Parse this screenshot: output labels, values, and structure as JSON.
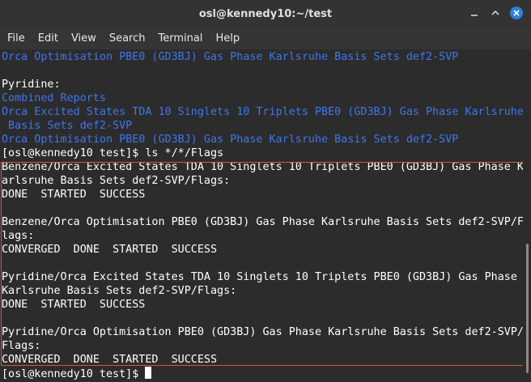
{
  "window": {
    "title": "osl@kennedy10:~/test"
  },
  "menu": [
    "File",
    "Edit",
    "View",
    "Search",
    "Terminal",
    "Help"
  ],
  "terminal_lines": [
    {
      "text": "Orca Optimisation PBE0 (GD3BJ) Gas Phase Karlsruhe Basis Sets def2-SVP",
      "color": "blue"
    },
    {
      "text": "",
      "color": "white"
    },
    {
      "text": "Pyridine:",
      "color": "white"
    },
    {
      "text": "Combined Reports",
      "color": "blue"
    },
    {
      "text": "Orca Excited States TDA 10 Singlets 10 Triplets PBE0 (GD3BJ) Gas Phase Karlsruhe",
      "color": "blue"
    },
    {
      "text": " Basis Sets def2-SVP",
      "color": "blue"
    },
    {
      "text": "Orca Optimisation PBE0 (GD3BJ) Gas Phase Karlsruhe Basis Sets def2-SVP",
      "color": "blue"
    },
    {
      "text": "[osl@kennedy10 test]$ ls */*/Flags",
      "color": "white"
    },
    {
      "text": "Benzene/Orca Excited States TDA 10 Singlets 10 Triplets PBE0 (GD3BJ) Gas Phase K",
      "color": "white"
    },
    {
      "text": "arlsruhe Basis Sets def2-SVP/Flags:",
      "color": "white"
    },
    {
      "text": "DONE  STARTED  SUCCESS",
      "color": "white"
    },
    {
      "text": "",
      "color": "white"
    },
    {
      "text": "Benzene/Orca Optimisation PBE0 (GD3BJ) Gas Phase Karlsruhe Basis Sets def2-SVP/F",
      "color": "white"
    },
    {
      "text": "lags:",
      "color": "white"
    },
    {
      "text": "CONVERGED  DONE  STARTED  SUCCESS",
      "color": "white"
    },
    {
      "text": "",
      "color": "white"
    },
    {
      "text": "Pyridine/Orca Excited States TDA 10 Singlets 10 Triplets PBE0 (GD3BJ) Gas Phase",
      "color": "white"
    },
    {
      "text": "Karlsruhe Basis Sets def2-SVP/Flags:",
      "color": "white"
    },
    {
      "text": "DONE  STARTED  SUCCESS",
      "color": "white"
    },
    {
      "text": "",
      "color": "white"
    },
    {
      "text": "Pyridine/Orca Optimisation PBE0 (GD3BJ) Gas Phase Karlsruhe Basis Sets def2-SVP/",
      "color": "white"
    },
    {
      "text": "Flags:",
      "color": "white"
    },
    {
      "text": "CONVERGED  DONE  STARTED  SUCCESS",
      "color": "white"
    },
    {
      "text": "[osl@kennedy10 test]$ ",
      "color": "white",
      "cursor": true
    }
  ],
  "colors": {
    "link_blue": "#3f76f0",
    "highlight_box": "#e0523a",
    "close_button": "#2f7fd6",
    "background": "#2c2c2c"
  },
  "icons": [
    "minimize-icon",
    "maximize-icon",
    "close-icon"
  ]
}
